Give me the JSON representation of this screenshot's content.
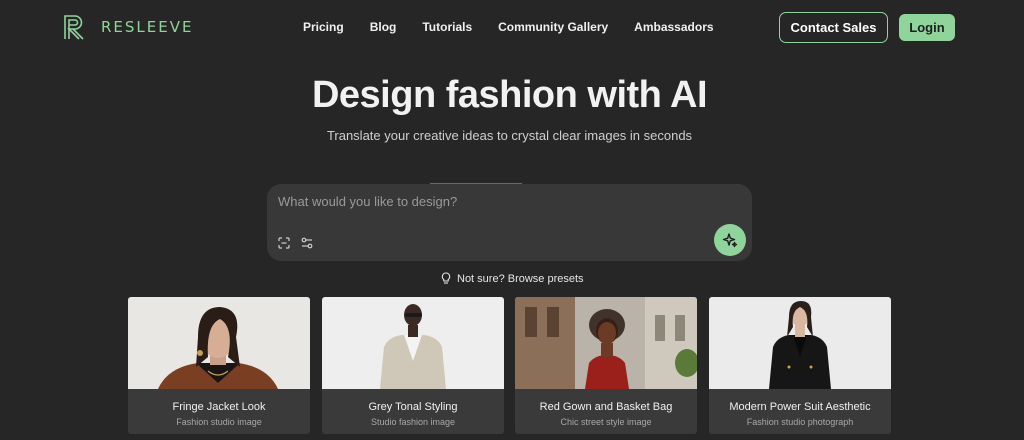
{
  "brand": {
    "name": "RESLEEVE",
    "accent": "#8fd49a"
  },
  "nav": {
    "items": [
      "Pricing",
      "Blog",
      "Tutorials",
      "Community Gallery",
      "Ambassadors"
    ]
  },
  "actions": {
    "contact_label": "Contact Sales",
    "login_label": "Login"
  },
  "hero": {
    "title": "Design fashion with AI",
    "subtitle": "Translate your creative ideas to crystal clear images in seconds"
  },
  "prompt": {
    "placeholder": "What would you like to design?",
    "icons": [
      "scan-icon",
      "tune-icon",
      "sparkle-icon"
    ]
  },
  "browse": {
    "label": "Not sure? Browse presets",
    "icon": "lightbulb-icon"
  },
  "presets": [
    {
      "title": "Fringe Jacket Look",
      "subtitle": "Fashion studio image"
    },
    {
      "title": "Grey Tonal Styling",
      "subtitle": "Studio fashion image"
    },
    {
      "title": "Red Gown and Basket Bag",
      "subtitle": "Chic street style image"
    },
    {
      "title": "Modern Power Suit Aesthetic",
      "subtitle": "Fashion studio photograph"
    }
  ]
}
